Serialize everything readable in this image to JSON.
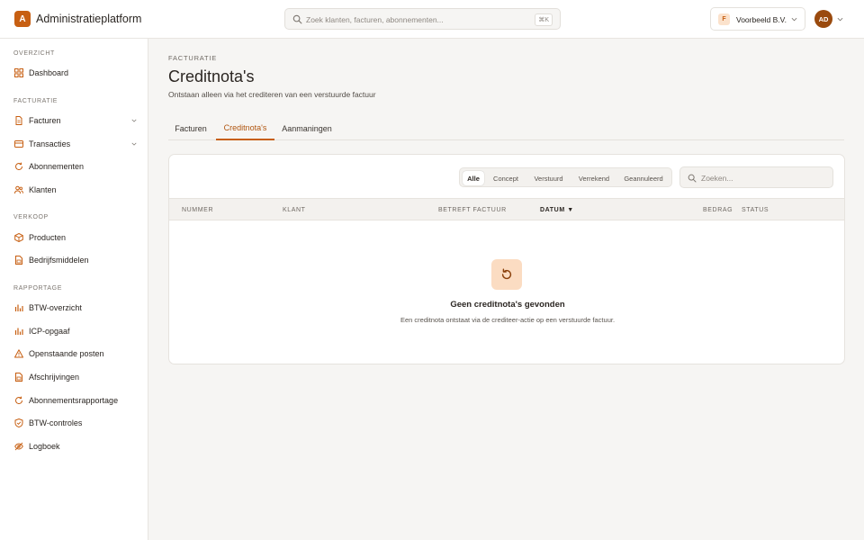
{
  "app": {
    "logo_letter": "A",
    "title": "Administratieplatform"
  },
  "search": {
    "placeholder": "Zoek klanten, facturen, abonnementen...",
    "shortcut": "⌘K"
  },
  "company": {
    "badge": "F",
    "name": "Voorbeeld B.V."
  },
  "user": {
    "initials": "AD"
  },
  "sidebar": {
    "sections": [
      {
        "label": "OVERZICHT"
      },
      {
        "label": "FACTURATIE"
      },
      {
        "label": "VERKOOP"
      },
      {
        "label": "RAPPORTAGE"
      }
    ],
    "items": [
      {
        "label": "Dashboard",
        "icon": "grid-icon"
      },
      {
        "label": "Facturen",
        "icon": "document-icon"
      },
      {
        "label": "Transacties",
        "icon": "card-icon"
      },
      {
        "label": "Abonnementen",
        "icon": "refresh-icon"
      },
      {
        "label": "Klanten",
        "icon": "users-icon"
      },
      {
        "label": "Producten",
        "icon": "box-icon"
      },
      {
        "label": "Bedrijfsmiddelen",
        "icon": "assets-icon"
      },
      {
        "label": "BTW-overzicht",
        "icon": "bar-chart-icon"
      },
      {
        "label": "ICP-opgaaf",
        "icon": "bar-chart-icon"
      },
      {
        "label": "Openstaande posten",
        "icon": "warning-icon"
      },
      {
        "label": "Afschrijvingen",
        "icon": "assets-icon"
      },
      {
        "label": "Abonnementsrapportage",
        "icon": "refresh-icon"
      },
      {
        "label": "BTW-controles",
        "icon": "shield-icon"
      },
      {
        "label": "Logboek",
        "icon": "eye-off-icon"
      }
    ]
  },
  "page": {
    "eyebrow": "FACTURATIE",
    "title": "Creditnota's",
    "subtitle": "Ontstaan alleen via het crediteren van een verstuurde factuur"
  },
  "tabs": [
    {
      "label": "Facturen"
    },
    {
      "label": "Creditnota's"
    },
    {
      "label": "Aanmaningen"
    }
  ],
  "filters": [
    {
      "label": "Alle"
    },
    {
      "label": "Concept"
    },
    {
      "label": "Verstuurd"
    },
    {
      "label": "Verrekend"
    },
    {
      "label": "Geannuleerd"
    }
  ],
  "table_search": {
    "placeholder": "Zoeken..."
  },
  "table": {
    "columns": [
      "NUMMER",
      "KLANT",
      "BETREFT FACTUUR",
      "DATUM ▼",
      "BEDRAG",
      "STATUS"
    ]
  },
  "empty": {
    "title": "Geen creditnota's gevonden",
    "subtitle": "Een creditnota ontstaat via de crediteer-actie op een verstuurde factuur."
  },
  "colors": {
    "accent": "#c75f12",
    "accent_soft": "#fbdcc2",
    "background": "#f6f5f3"
  }
}
